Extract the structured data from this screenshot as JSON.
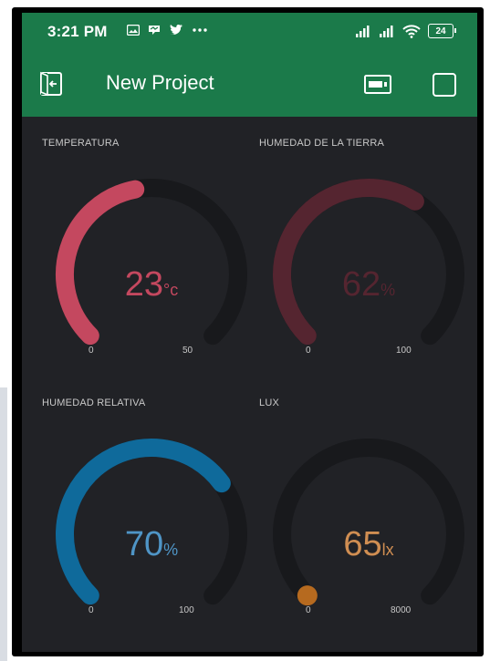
{
  "status_bar": {
    "time": "3:21 PM",
    "battery": "24",
    "icons": [
      "gallery-icon",
      "messenger-icon",
      "twitter-icon",
      "more-dots-icon",
      "signal-icon",
      "signal-icon-2",
      "wifi-icon"
    ]
  },
  "app_bar": {
    "title": "New Project",
    "exit_icon": "exit-icon",
    "device_icon": "device-icon",
    "square_icon": "square-icon"
  },
  "colors": {
    "accent_green": "#1b7a4a",
    "background": "#212226",
    "track": "#18191c"
  },
  "widgets": [
    {
      "label": "TEMPERATURA",
      "value": "23",
      "unit": "°c",
      "min": "0",
      "max": "50",
      "fraction": 0.46,
      "arc_color": "#c4485f",
      "text_color": "#c4485f",
      "dot": false
    },
    {
      "label": "HUMEDAD DE LA TIERRA",
      "value": "62",
      "unit": "%",
      "min": "0",
      "max": "100",
      "fraction": 0.62,
      "arc_color": "#552530",
      "text_color": "#552530",
      "dot": false
    },
    {
      "label": "HUMEDAD RELATIVA",
      "value": "70",
      "unit": "%",
      "min": "0",
      "max": "100",
      "fraction": 0.7,
      "arc_color": "#0f6a9b",
      "text_color": "#4f95c6",
      "dot": false
    },
    {
      "label": "LUX",
      "value": "65",
      "unit": "lx",
      "min": "0",
      "max": "8000",
      "fraction": 0.008,
      "arc_color": "#b66a1f",
      "text_color": "#d08e52",
      "dot": true
    }
  ]
}
